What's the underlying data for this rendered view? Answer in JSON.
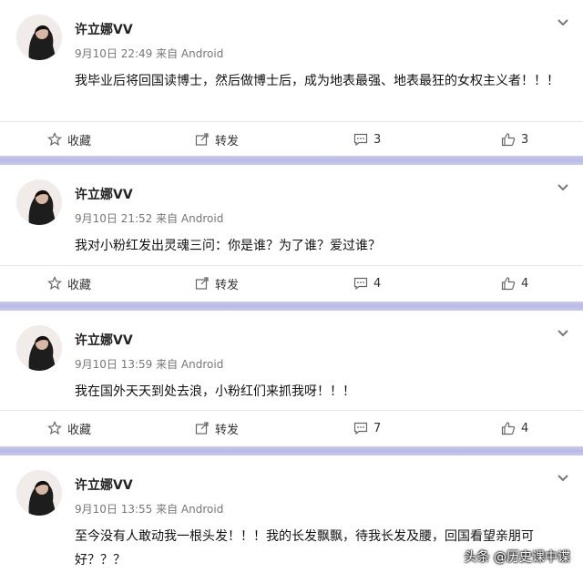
{
  "posts": [
    {
      "username": "许立娜VV",
      "time": "9月10日 22:49 来自 Android",
      "content": "我毕业后将回国读博士，然后做博士后，成为地表最强、地表最狂的女权主义者！！！",
      "actions": {
        "favorite_label": "收藏",
        "forward_label": "转发",
        "comments": "3",
        "likes": "3"
      }
    },
    {
      "username": "许立娜VV",
      "time": "9月10日 21:52 来自 Android",
      "content": "我对小粉红发出灵魂三问：你是谁？为了谁？爱过谁？",
      "actions": {
        "favorite_label": "收藏",
        "forward_label": "转发",
        "comments": "4",
        "likes": "4"
      }
    },
    {
      "username": "许立娜VV",
      "time": "9月10日 13:59 来自 Android",
      "content": "我在国外天天到处去浪，小粉红们来抓我呀！！！",
      "actions": {
        "favorite_label": "收藏",
        "forward_label": "转发",
        "comments": "7",
        "likes": "4"
      }
    },
    {
      "username": "许立娜VV",
      "time": "9月10日 13:55 来自 Android",
      "content": "至今没有人敢动我一根头发！！！我的长发飘飘，待我长发及腰，回国看望亲朋可好？？？",
      "actions": {}
    }
  ],
  "watermark": {
    "text": "头条 @历史课中谍"
  },
  "icons": {
    "avatar": "user-avatar",
    "menu": "chevron-down-icon",
    "favorite": "star-icon",
    "forward": "share-icon",
    "comment": "comment-icon",
    "like": "thumbs-up-icon"
  },
  "colors": {
    "separator": "#c4c4ec",
    "text": "#111111",
    "meta": "#777777"
  }
}
